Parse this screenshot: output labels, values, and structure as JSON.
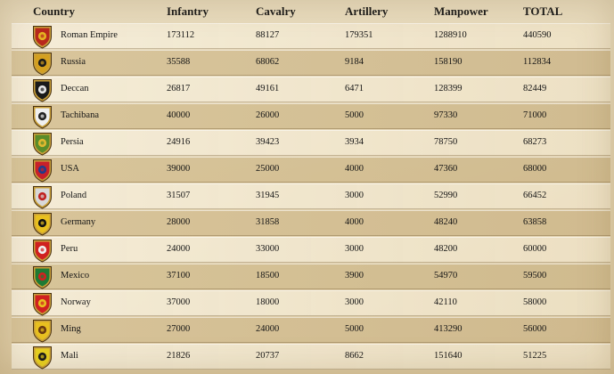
{
  "columns": [
    "Country",
    "Infantry",
    "Cavalry",
    "Artillery",
    "Manpower",
    "TOTAL"
  ],
  "rows": [
    {
      "country": "Roman Empire",
      "infantry": "173112",
      "cavalry": "88127",
      "artillery": "179351",
      "manpower": "1288910",
      "total": "440590",
      "flag": "roman-empire-shield-icon",
      "colors": [
        "#b8281c",
        "#e6b422"
      ]
    },
    {
      "country": "Russia",
      "infantry": "35588",
      "cavalry": "68062",
      "artillery": "9184",
      "manpower": "158190",
      "total": "112834",
      "flag": "russia-shield-icon",
      "colors": [
        "#d4a020",
        "#1a1a1a"
      ]
    },
    {
      "country": "Deccan",
      "infantry": "26817",
      "cavalry": "49161",
      "artillery": "6471",
      "manpower": "128399",
      "total": "82449",
      "flag": "deccan-shield-icon",
      "colors": [
        "#1a1a1a",
        "#e8e8e8"
      ]
    },
    {
      "country": "Tachibana",
      "infantry": "40000",
      "cavalry": "26000",
      "artillery": "5000",
      "manpower": "97330",
      "total": "71000",
      "flag": "tachibana-shield-icon",
      "colors": [
        "#f0f0f0",
        "#222222"
      ]
    },
    {
      "country": "Persia",
      "infantry": "24916",
      "cavalry": "39423",
      "artillery": "3934",
      "manpower": "78750",
      "total": "68273",
      "flag": "persia-shield-icon",
      "colors": [
        "#5a8c2a",
        "#e0b830"
      ]
    },
    {
      "country": "USA",
      "infantry": "39000",
      "cavalry": "25000",
      "artillery": "4000",
      "manpower": "47360",
      "total": "68000",
      "flag": "usa-shield-icon",
      "colors": [
        "#c8202a",
        "#203c8c"
      ]
    },
    {
      "country": "Poland",
      "infantry": "31507",
      "cavalry": "31945",
      "artillery": "3000",
      "manpower": "52990",
      "total": "66452",
      "flag": "poland-shield-icon",
      "colors": [
        "#d8d8d8",
        "#c02020"
      ]
    },
    {
      "country": "Germany",
      "infantry": "28000",
      "cavalry": "31858",
      "artillery": "4000",
      "manpower": "48240",
      "total": "63858",
      "flag": "germany-shield-icon",
      "colors": [
        "#e8c020",
        "#111111"
      ]
    },
    {
      "country": "Peru",
      "infantry": "24000",
      "cavalry": "33000",
      "artillery": "3000",
      "manpower": "48200",
      "total": "60000",
      "flag": "peru-shield-icon",
      "colors": [
        "#d02020",
        "#f0f0f0"
      ]
    },
    {
      "country": "Mexico",
      "infantry": "37100",
      "cavalry": "18500",
      "artillery": "3900",
      "manpower": "54970",
      "total": "59500",
      "flag": "mexico-shield-icon",
      "colors": [
        "#1e7a34",
        "#d02020"
      ]
    },
    {
      "country": "Norway",
      "infantry": "37000",
      "cavalry": "18000",
      "artillery": "3000",
      "manpower": "42110",
      "total": "58000",
      "flag": "norway-shield-icon",
      "colors": [
        "#d02020",
        "#e8c020"
      ]
    },
    {
      "country": "Ming",
      "infantry": "27000",
      "cavalry": "24000",
      "artillery": "5000",
      "manpower": "413290",
      "total": "56000",
      "flag": "ming-shield-icon",
      "colors": [
        "#e8c020",
        "#6a3a10"
      ]
    },
    {
      "country": "Mali",
      "infantry": "21826",
      "cavalry": "20737",
      "artillery": "8662",
      "manpower": "151640",
      "total": "51225",
      "flag": "mali-shield-icon",
      "colors": [
        "#e8d020",
        "#1a1a1a"
      ]
    }
  ]
}
